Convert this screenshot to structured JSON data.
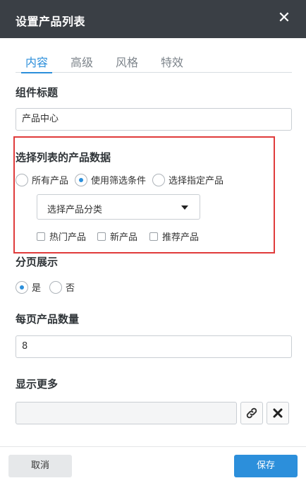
{
  "dialog": {
    "title": "设置产品列表",
    "close_icon": "close-icon"
  },
  "tabs": [
    {
      "label": "内容",
      "active": true
    },
    {
      "label": "高级",
      "active": false
    },
    {
      "label": "风格",
      "active": false
    },
    {
      "label": "特效",
      "active": false
    }
  ],
  "widget_title": {
    "label": "组件标题",
    "value": "产品中心"
  },
  "product_data": {
    "label": "选择列表的产品数据",
    "options": [
      {
        "label": "所有产品",
        "checked": false
      },
      {
        "label": "使用筛选条件",
        "checked": true
      },
      {
        "label": "选择指定产品",
        "checked": false
      }
    ],
    "category_select": "选择产品分类",
    "filters": [
      {
        "label": "热门产品",
        "checked": false
      },
      {
        "label": "新产品",
        "checked": false
      },
      {
        "label": "推荐产品",
        "checked": false
      }
    ]
  },
  "pagination": {
    "label": "分页展示",
    "options": [
      {
        "label": "是",
        "checked": true
      },
      {
        "label": "否",
        "checked": false
      }
    ]
  },
  "per_page": {
    "label": "每页产品数量",
    "value": "8"
  },
  "show_more": {
    "label": "显示更多",
    "value": "",
    "link_icon": "link-icon",
    "clear_icon": "clear-icon"
  },
  "footer": {
    "cancel_label": "取消",
    "save_label": "保存"
  },
  "colors": {
    "accent": "#2c8fdb",
    "titlebar": "#3a3f45",
    "highlight_border": "#e03b3b"
  }
}
